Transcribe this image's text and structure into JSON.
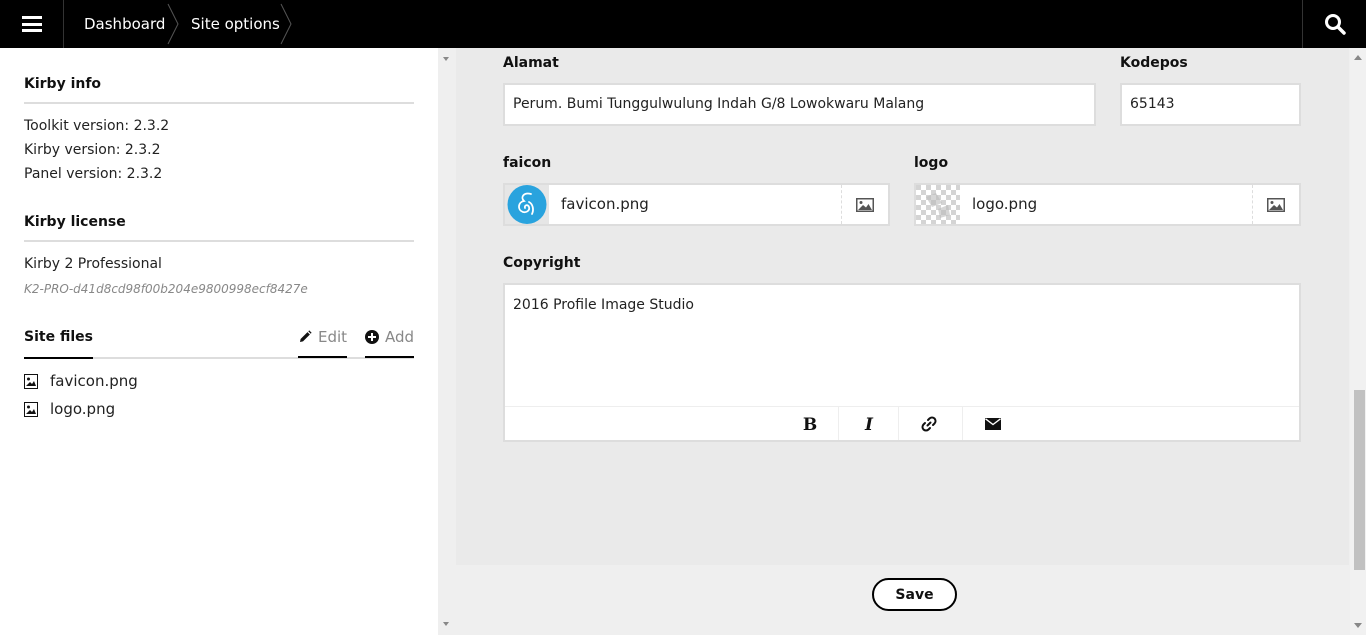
{
  "topbar": {
    "breadcrumbs": [
      {
        "label": "Dashboard"
      },
      {
        "label": "Site options"
      }
    ]
  },
  "sidebar": {
    "info_title": "Kirby info",
    "toolkit_version": "Toolkit version: 2.3.2",
    "kirby_version": "Kirby version: 2.3.2",
    "panel_version": "Panel version: 2.3.2",
    "license_title": "Kirby license",
    "license_name": "Kirby 2 Professional",
    "license_key": "K2-PRO-d41d8cd98f00b204e9800998ecf8427e",
    "files_title": "Site files",
    "edit_label": "Edit",
    "add_label": "Add",
    "files": [
      "favicon.png",
      "logo.png"
    ]
  },
  "form": {
    "alamat_label": "Alamat",
    "alamat_value": "Perum. Bumi Tunggulwulung Indah G/8 Lowokwaru Malang",
    "kodepos_label": "Kodepos",
    "kodepos_value": "65143",
    "faicon_label": "faicon",
    "faicon_value": "favicon.png",
    "logo_label": "logo",
    "logo_value": "logo.png",
    "copyright_label": "Copyright",
    "copyright_value": "2016 Profile Image Studio",
    "save_label": "Save"
  },
  "colors": {
    "topbar": "#000000",
    "favicon_blue": "#29a3de"
  }
}
